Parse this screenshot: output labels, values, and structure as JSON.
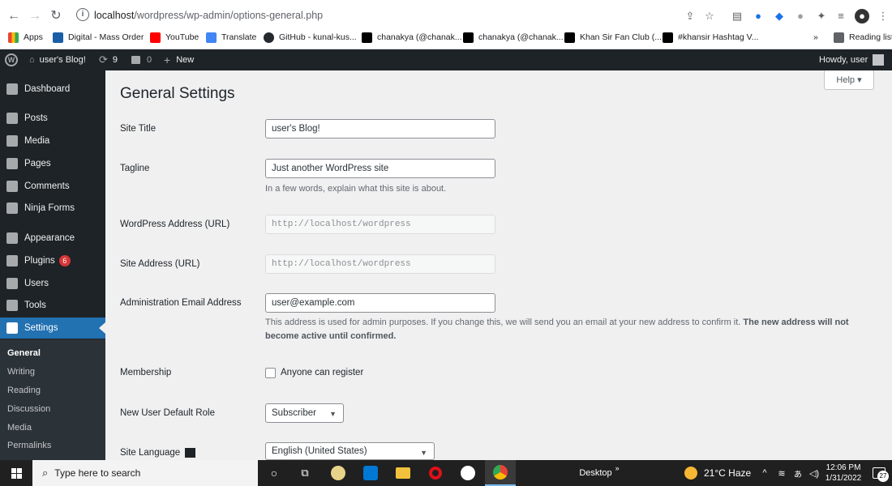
{
  "browser": {
    "url_prefix": "localhost",
    "url_path": "/wordpress/wp-admin/options-general.php",
    "bookmarks": [
      "Apps",
      "Digital - Mass Order",
      "YouTube",
      "Translate",
      "GitHub - kunal-kus...",
      "chanakya (@chanak...",
      "chanakya (@chanak...",
      "Khan Sir Fan Club (...",
      "#khansir Hashtag V..."
    ],
    "overflow": "»",
    "reading_list": "Reading list"
  },
  "adminbar": {
    "site_name": "user's Blog!",
    "updates": "9",
    "comments": "0",
    "new_label": "New",
    "howdy": "Howdy, user"
  },
  "sidebar": {
    "items": [
      {
        "label": "Dashboard"
      },
      {
        "label": "Posts"
      },
      {
        "label": "Media"
      },
      {
        "label": "Pages"
      },
      {
        "label": "Comments"
      },
      {
        "label": "Ninja Forms"
      },
      {
        "label": "Appearance"
      },
      {
        "label": "Plugins",
        "badge": "6"
      },
      {
        "label": "Users"
      },
      {
        "label": "Tools"
      },
      {
        "label": "Settings"
      }
    ],
    "submenu": [
      "General",
      "Writing",
      "Reading",
      "Discussion",
      "Media",
      "Permalinks"
    ]
  },
  "main": {
    "help": "Help ▾",
    "title": "General Settings",
    "site_title_label": "Site Title",
    "site_title_value": "user's Blog!",
    "tagline_label": "Tagline",
    "tagline_value": "Just another WordPress site",
    "tagline_desc": "In a few words, explain what this site is about.",
    "wp_address_label": "WordPress Address (URL)",
    "wp_address_value": "http://localhost/wordpress",
    "site_address_label": "Site Address (URL)",
    "site_address_value": "http://localhost/wordpress",
    "admin_email_label": "Administration Email Address",
    "admin_email_value": "user@example.com",
    "admin_email_desc": "This address is used for admin purposes. If you change this, we will send you an email at your new address to confirm it.",
    "admin_email_desc_bold": "The new address will not become active until confirmed.",
    "membership_label": "Membership",
    "membership_checkbox": "Anyone can register",
    "default_role_label": "New User Default Role",
    "default_role_value": "Subscriber",
    "language_label": "Site Language",
    "language_value": "English (United States)"
  },
  "taskbar": {
    "search_placeholder": "Type here to search",
    "desktop": "Desktop",
    "weather": "21°C  Haze",
    "time": "12:06 PM",
    "date": "1/31/2022",
    "notifications": "27"
  }
}
